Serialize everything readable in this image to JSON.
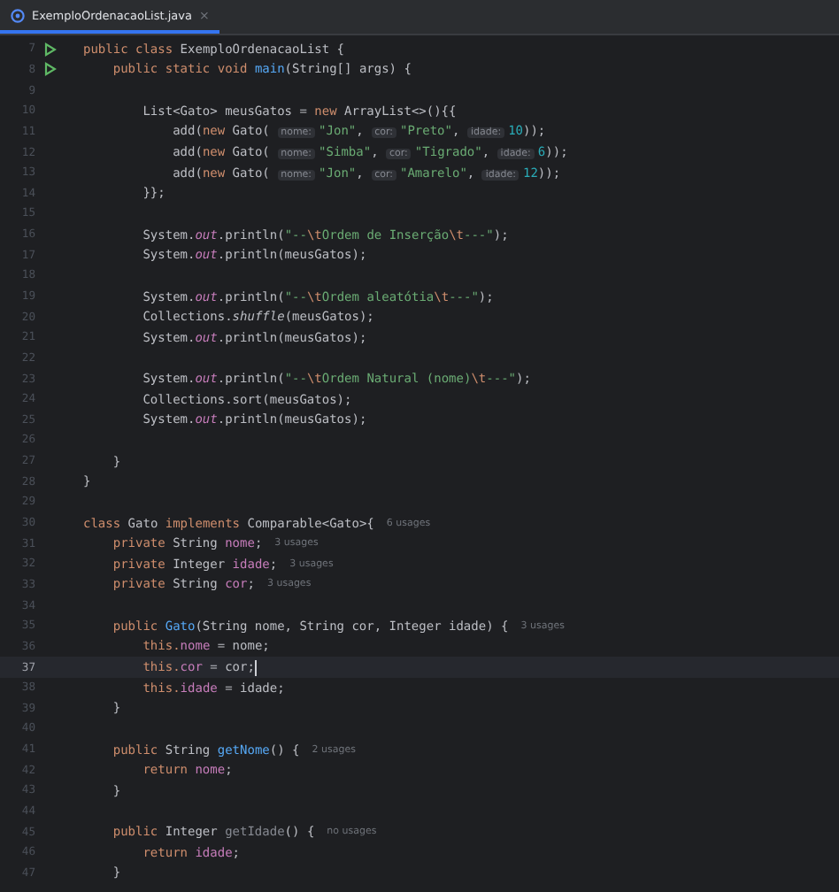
{
  "tab": {
    "label": "ExemploOrdenacaoList.java",
    "close": "×",
    "selected": true
  },
  "lines": [
    {
      "number": "7",
      "runnable": true,
      "current": false,
      "tokens": [
        {
          "kind": "keyword",
          "text": "public class "
        },
        {
          "kind": "plain",
          "text": "ExemploOrdenacaoList {"
        }
      ]
    },
    {
      "number": "8",
      "runnable": true,
      "current": false,
      "tokens": [
        {
          "kind": "keyword",
          "text": "    public static void "
        },
        {
          "kind": "method",
          "text": "main"
        },
        {
          "kind": "plain",
          "text": "(String[] args) {"
        }
      ]
    },
    {
      "number": "9",
      "runnable": false,
      "current": false
    },
    {
      "number": "10",
      "runnable": false,
      "current": false,
      "tokens": [
        {
          "kind": "plain",
          "text": "        List<Gato> meusGatos = "
        },
        {
          "kind": "keyword",
          "text": "new "
        },
        {
          "kind": "plain",
          "text": "ArrayList<>(){{"
        }
      ]
    },
    {
      "number": "11",
      "runnable": false,
      "current": false,
      "tokens": [
        {
          "kind": "plain",
          "text": "            add("
        },
        {
          "kind": "keyword",
          "text": "new "
        },
        {
          "kind": "plain",
          "text": "Gato( "
        },
        {
          "kind": "param-hint",
          "text": "nome:"
        },
        {
          "kind": "string",
          "text": "\"Jon\""
        },
        {
          "kind": "plain",
          "text": ", "
        },
        {
          "kind": "param-hint",
          "text": "cor:"
        },
        {
          "kind": "string",
          "text": "\"Preto\""
        },
        {
          "kind": "plain",
          "text": ", "
        },
        {
          "kind": "param-hint",
          "text": "idade:"
        },
        {
          "kind": "number",
          "text": "10"
        },
        {
          "kind": "plain",
          "text": "));"
        }
      ]
    },
    {
      "number": "12",
      "runnable": false,
      "current": false,
      "tokens": [
        {
          "kind": "plain",
          "text": "            add("
        },
        {
          "kind": "keyword",
          "text": "new "
        },
        {
          "kind": "plain",
          "text": "Gato( "
        },
        {
          "kind": "param-hint",
          "text": "nome:"
        },
        {
          "kind": "string",
          "text": "\"Simba\""
        },
        {
          "kind": "plain",
          "text": ", "
        },
        {
          "kind": "param-hint",
          "text": "cor:"
        },
        {
          "kind": "string",
          "text": "\"Tigrado\""
        },
        {
          "kind": "plain",
          "text": ", "
        },
        {
          "kind": "param-hint",
          "text": "idade:"
        },
        {
          "kind": "number",
          "text": "6"
        },
        {
          "kind": "plain",
          "text": "));"
        }
      ]
    },
    {
      "number": "13",
      "runnable": false,
      "current": false,
      "tokens": [
        {
          "kind": "plain",
          "text": "            add("
        },
        {
          "kind": "keyword",
          "text": "new "
        },
        {
          "kind": "plain",
          "text": "Gato( "
        },
        {
          "kind": "param-hint",
          "text": "nome:"
        },
        {
          "kind": "string",
          "text": "\"Jon\""
        },
        {
          "kind": "plain",
          "text": ", "
        },
        {
          "kind": "param-hint",
          "text": "cor:"
        },
        {
          "kind": "string",
          "text": "\"Amarelo\""
        },
        {
          "kind": "plain",
          "text": ", "
        },
        {
          "kind": "param-hint",
          "text": "idade:"
        },
        {
          "kind": "number",
          "text": "12"
        },
        {
          "kind": "plain",
          "text": "));"
        }
      ]
    },
    {
      "number": "14",
      "runnable": false,
      "current": false,
      "tokens": [
        {
          "kind": "plain",
          "text": "        }};"
        }
      ]
    },
    {
      "number": "15",
      "runnable": false,
      "current": false
    },
    {
      "number": "16",
      "runnable": false,
      "current": false,
      "tokens": [
        {
          "kind": "plain",
          "text": "        System."
        },
        {
          "kind": "static",
          "text": "out"
        },
        {
          "kind": "plain",
          "text": ".println("
        },
        {
          "kind": "string",
          "text": "\"--"
        },
        {
          "kind": "escape",
          "text": "\\t"
        },
        {
          "kind": "string",
          "text": "Ordem de Inserção"
        },
        {
          "kind": "escape",
          "text": "\\t"
        },
        {
          "kind": "string",
          "text": "---\""
        },
        {
          "kind": "plain",
          "text": ");"
        }
      ]
    },
    {
      "number": "17",
      "runnable": false,
      "current": false,
      "tokens": [
        {
          "kind": "plain",
          "text": "        System."
        },
        {
          "kind": "static",
          "text": "out"
        },
        {
          "kind": "plain",
          "text": ".println(meusGatos);"
        }
      ]
    },
    {
      "number": "18",
      "runnable": false,
      "current": false
    },
    {
      "number": "19",
      "runnable": false,
      "current": false,
      "tokens": [
        {
          "kind": "plain",
          "text": "        System."
        },
        {
          "kind": "static",
          "text": "out"
        },
        {
          "kind": "plain",
          "text": ".println("
        },
        {
          "kind": "string",
          "text": "\"--"
        },
        {
          "kind": "escape",
          "text": "\\t"
        },
        {
          "kind": "string",
          "text": "Ordem aleatótia"
        },
        {
          "kind": "escape",
          "text": "\\t"
        },
        {
          "kind": "string",
          "text": "---\""
        },
        {
          "kind": "plain",
          "text": ");"
        }
      ]
    },
    {
      "number": "20",
      "runnable": false,
      "current": false,
      "tokens": [
        {
          "kind": "plain",
          "text": "        Collections."
        },
        {
          "kind": "static-call",
          "text": "shuffle"
        },
        {
          "kind": "plain",
          "text": "(meusGatos);"
        }
      ]
    },
    {
      "number": "21",
      "runnable": false,
      "current": false,
      "tokens": [
        {
          "kind": "plain",
          "text": "        System."
        },
        {
          "kind": "static",
          "text": "out"
        },
        {
          "kind": "plain",
          "text": ".println(meusGatos);"
        }
      ]
    },
    {
      "number": "22",
      "runnable": false,
      "current": false
    },
    {
      "number": "23",
      "runnable": false,
      "current": false,
      "tokens": [
        {
          "kind": "plain",
          "text": "        System."
        },
        {
          "kind": "static",
          "text": "out"
        },
        {
          "kind": "plain",
          "text": ".println("
        },
        {
          "kind": "string",
          "text": "\"--"
        },
        {
          "kind": "escape",
          "text": "\\t"
        },
        {
          "kind": "string",
          "text": "Ordem Natural (nome)"
        },
        {
          "kind": "escape",
          "text": "\\t"
        },
        {
          "kind": "string",
          "text": "---\""
        },
        {
          "kind": "plain",
          "text": ");"
        }
      ]
    },
    {
      "number": "24",
      "runnable": false,
      "current": false,
      "tokens": [
        {
          "kind": "plain",
          "text": "        Collections.sort(meusGatos);"
        }
      ]
    },
    {
      "number": "25",
      "runnable": false,
      "current": false,
      "tokens": [
        {
          "kind": "plain",
          "text": "        System."
        },
        {
          "kind": "static",
          "text": "out"
        },
        {
          "kind": "plain",
          "text": ".println(meusGatos);"
        }
      ]
    },
    {
      "number": "26",
      "runnable": false,
      "current": false
    },
    {
      "number": "27",
      "runnable": false,
      "current": false,
      "tokens": [
        {
          "kind": "plain",
          "text": "    }"
        }
      ]
    },
    {
      "number": "28",
      "runnable": false,
      "current": false,
      "tokens": [
        {
          "kind": "plain",
          "text": "}"
        }
      ]
    },
    {
      "number": "29",
      "runnable": false,
      "current": false
    },
    {
      "number": "30",
      "runnable": false,
      "current": false,
      "usages": "6 usages",
      "tokens": [
        {
          "kind": "keyword",
          "text": "class "
        },
        {
          "kind": "plain",
          "text": "Gato "
        },
        {
          "kind": "keyword",
          "text": "implements "
        },
        {
          "kind": "plain",
          "text": "Comparable<Gato>{"
        }
      ]
    },
    {
      "number": "31",
      "runnable": false,
      "current": false,
      "usages": "3 usages",
      "tokens": [
        {
          "kind": "keyword",
          "text": "    private "
        },
        {
          "kind": "plain",
          "text": "String "
        },
        {
          "kind": "field",
          "text": "nome"
        },
        {
          "kind": "plain",
          "text": ";"
        }
      ]
    },
    {
      "number": "32",
      "runnable": false,
      "current": false,
      "usages": "3 usages",
      "tokens": [
        {
          "kind": "keyword",
          "text": "    private "
        },
        {
          "kind": "plain",
          "text": "Integer "
        },
        {
          "kind": "field",
          "text": "idade"
        },
        {
          "kind": "plain",
          "text": ";"
        }
      ]
    },
    {
      "number": "33",
      "runnable": false,
      "current": false,
      "usages": "3 usages",
      "tokens": [
        {
          "kind": "keyword",
          "text": "    private "
        },
        {
          "kind": "plain",
          "text": "String "
        },
        {
          "kind": "field",
          "text": "cor"
        },
        {
          "kind": "plain",
          "text": ";"
        }
      ]
    },
    {
      "number": "34",
      "runnable": false,
      "current": false
    },
    {
      "number": "35",
      "runnable": false,
      "current": false,
      "usages": "3 usages",
      "tokens": [
        {
          "kind": "keyword",
          "text": "    public "
        },
        {
          "kind": "method",
          "text": "Gato"
        },
        {
          "kind": "plain",
          "text": "(String nome, String cor, Integer idade) {"
        }
      ]
    },
    {
      "number": "36",
      "runnable": false,
      "current": false,
      "tokens": [
        {
          "kind": "keyword",
          "text": "        this."
        },
        {
          "kind": "field",
          "text": "nome"
        },
        {
          "kind": "plain",
          "text": " = nome;"
        }
      ]
    },
    {
      "number": "37",
      "runnable": false,
      "current": true,
      "tokens": [
        {
          "kind": "keyword",
          "text": "        this."
        },
        {
          "kind": "field",
          "text": "cor"
        },
        {
          "kind": "plain",
          "text": " = cor;"
        }
      ]
    },
    {
      "number": "38",
      "runnable": false,
      "current": false,
      "tokens": [
        {
          "kind": "keyword",
          "text": "        this."
        },
        {
          "kind": "field",
          "text": "idade"
        },
        {
          "kind": "plain",
          "text": " = idade;"
        }
      ]
    },
    {
      "number": "39",
      "runnable": false,
      "current": false,
      "tokens": [
        {
          "kind": "plain",
          "text": "    }"
        }
      ]
    },
    {
      "number": "40",
      "runnable": false,
      "current": false
    },
    {
      "number": "41",
      "runnable": false,
      "current": false,
      "usages": "2 usages",
      "tokens": [
        {
          "kind": "keyword",
          "text": "    public "
        },
        {
          "kind": "plain",
          "text": "String "
        },
        {
          "kind": "method",
          "text": "getNome"
        },
        {
          "kind": "plain",
          "text": "() {"
        }
      ]
    },
    {
      "number": "42",
      "runnable": false,
      "current": false,
      "tokens": [
        {
          "kind": "keyword",
          "text": "        return "
        },
        {
          "kind": "field",
          "text": "nome"
        },
        {
          "kind": "plain",
          "text": ";"
        }
      ]
    },
    {
      "number": "43",
      "runnable": false,
      "current": false,
      "tokens": [
        {
          "kind": "plain",
          "text": "    }"
        }
      ]
    },
    {
      "number": "44",
      "runnable": false,
      "current": false
    },
    {
      "number": "45",
      "runnable": false,
      "current": false,
      "usages": "no usages",
      "tokens": [
        {
          "kind": "keyword",
          "text": "    public "
        },
        {
          "kind": "plain",
          "text": "Integer "
        },
        {
          "kind": "unused",
          "text": "getIdade"
        },
        {
          "kind": "plain",
          "text": "() {"
        }
      ]
    },
    {
      "number": "46",
      "runnable": false,
      "current": false,
      "tokens": [
        {
          "kind": "keyword",
          "text": "        return "
        },
        {
          "kind": "field",
          "text": "idade"
        },
        {
          "kind": "plain",
          "text": ";"
        }
      ]
    },
    {
      "number": "47",
      "runnable": false,
      "current": false,
      "tokens": [
        {
          "kind": "plain",
          "text": "    }"
        }
      ]
    }
  ]
}
